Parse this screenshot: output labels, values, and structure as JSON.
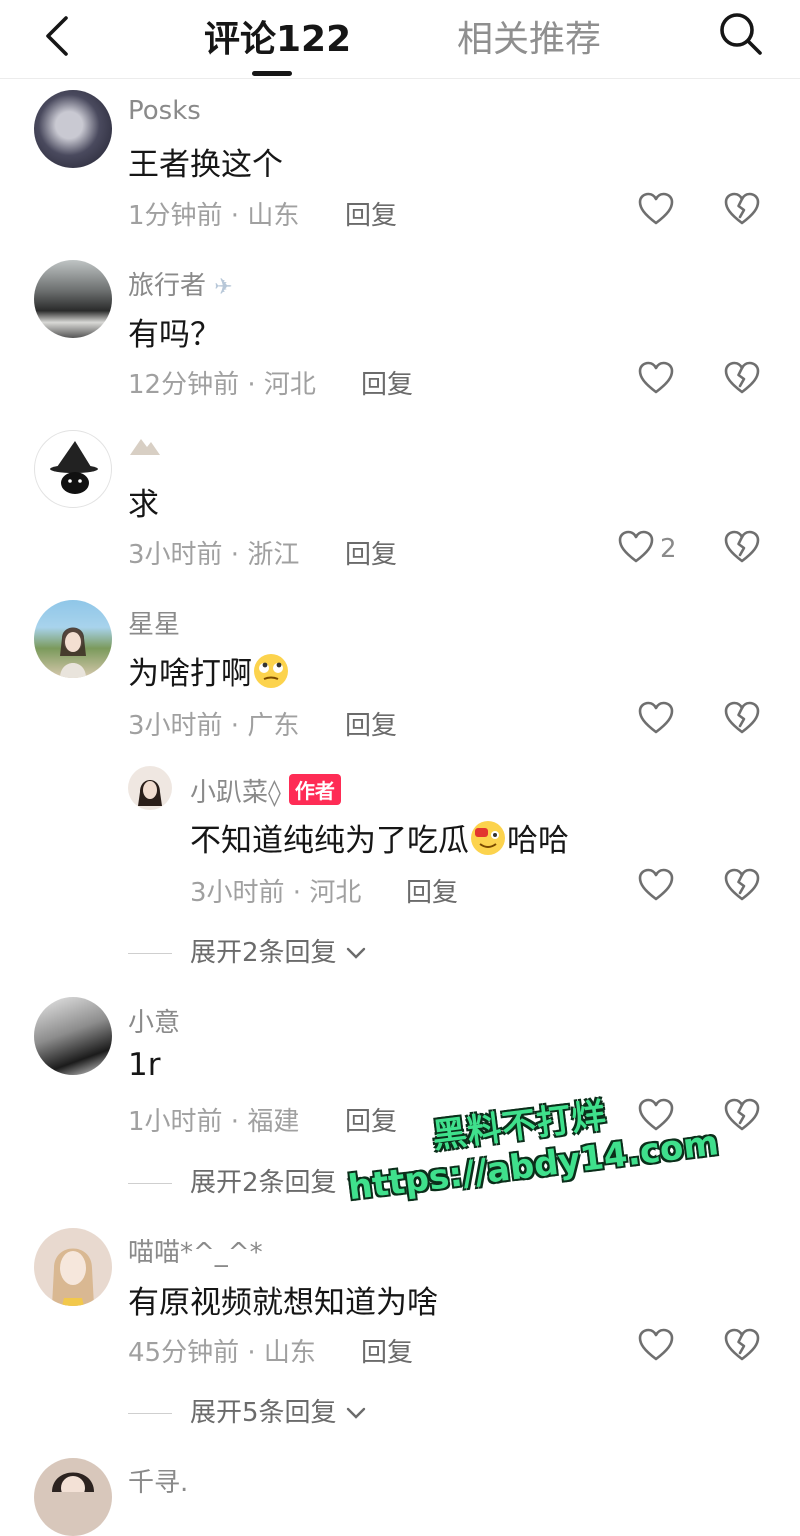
{
  "header": {
    "comments_tab": "评论122",
    "related_tab": "相关推荐"
  },
  "comments": [
    {
      "user": "Posks",
      "text": "王者换这个",
      "time": "1分钟前 · 山东",
      "reply": "回复"
    },
    {
      "user": "旅行者",
      "text": "有吗？",
      "time": "12分钟前 · 河北",
      "reply": "回复"
    },
    {
      "user": "",
      "text": "求",
      "time": "3小时前 · 浙江",
      "reply": "回复",
      "likes": "2"
    },
    {
      "user": "星星",
      "text": "为啥打啊",
      "time": "3小时前 · 广东",
      "reply": "回复"
    },
    {
      "user": "小意",
      "text": "1r",
      "time": "1小时前 · 福建",
      "reply": "回复"
    },
    {
      "user": "喵喵*^_^*",
      "text": "有原视频就想知道为啥",
      "time": "45分钟前 · 山东",
      "reply": "回复"
    },
    {
      "user": "千寻."
    }
  ],
  "subreply": {
    "user": "小趴菜◊",
    "badge": "作者",
    "text_a": "不知道纯纯为了吃瓜",
    "text_b": "哈哈",
    "time": "3小时前 · 河北",
    "reply": "回复"
  },
  "expand": [
    "展开2条回复",
    "展开2条回复",
    "展开5条回复"
  ],
  "watermark": {
    "line1": "黑料不打烊",
    "line2": "https://abdy14.com"
  },
  "colors": {
    "accent": "#fe2c55",
    "watermark": "#3fe08c"
  }
}
